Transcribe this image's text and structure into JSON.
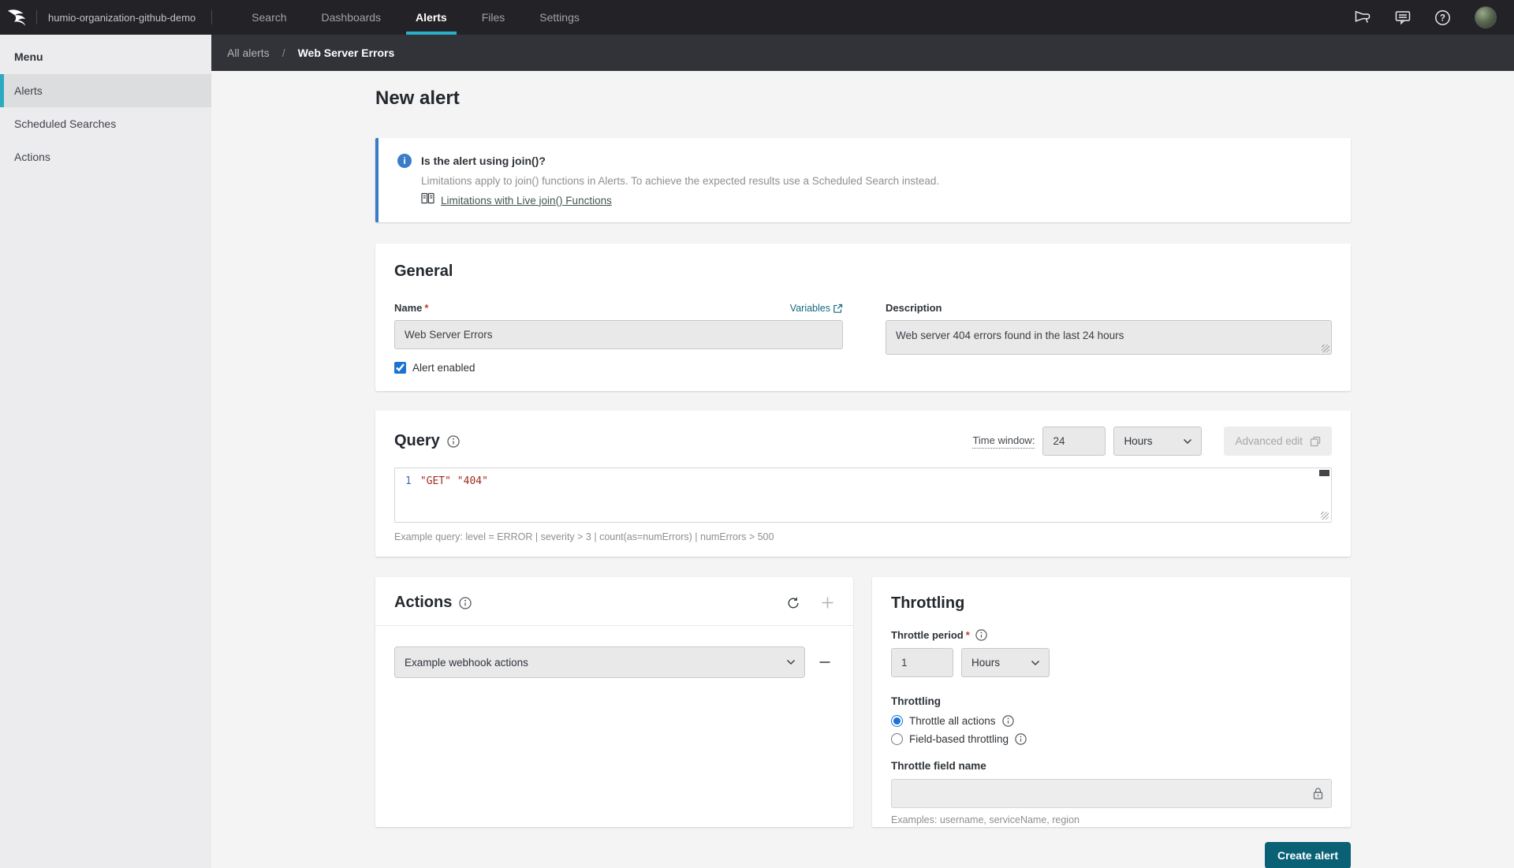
{
  "nav": {
    "org": "humio-organization-github-demo",
    "items": [
      "Search",
      "Dashboards",
      "Alerts",
      "Files",
      "Settings"
    ],
    "active_item": "Alerts"
  },
  "breadcrumb": {
    "parent": "All alerts",
    "separator": "/",
    "current": "Web Server Errors"
  },
  "sidebar": {
    "title": "Menu",
    "items": [
      "Alerts",
      "Scheduled Searches",
      "Actions"
    ],
    "active_item": "Alerts"
  },
  "page": {
    "title": "New alert"
  },
  "info_banner": {
    "title": "Is the alert using join()?",
    "body": "Limitations apply to join() functions in Alerts. To achieve the expected results use a Scheduled Search instead.",
    "link": "Limitations with Live join() Functions"
  },
  "general": {
    "heading": "General",
    "name_label": "Name",
    "required_mark": "*",
    "variables_link": "Variables",
    "name_value": "Web Server Errors",
    "description_label": "Description",
    "description_value": "Web server 404 errors found in the last 24 hours",
    "alert_enabled_label": "Alert enabled",
    "alert_enabled": true
  },
  "query": {
    "heading": "Query",
    "time_window_label": "Time window:",
    "time_window_value": "24",
    "time_window_unit": "Hours",
    "advanced_edit_label": "Advanced edit",
    "line_number": "1",
    "code": "\"GET\" \"404\"",
    "example": "Example query: level = ERROR | severity > 3 | count(as=numErrors) | numErrors > 500"
  },
  "actions": {
    "heading": "Actions",
    "selected_action": "Example webhook actions"
  },
  "throttling": {
    "heading": "Throttling",
    "period_label": "Throttle period",
    "required_mark": "*",
    "period_value": "1",
    "period_unit": "Hours",
    "subheading": "Throttling",
    "radio_all_label": "Throttle all actions",
    "radio_field_label": "Field-based throttling",
    "selected_radio": "Throttle all actions",
    "field_name_label": "Throttle field name",
    "field_name_value": "",
    "examples": "Examples: username, serviceName, region"
  },
  "footer": {
    "create_label": "Create alert"
  },
  "colors": {
    "navbar_bg": "#232327",
    "breadcrumb_bg": "#313338",
    "sidebar_bg": "#ececee",
    "page_bg": "#f4f4f5",
    "card_bg": "#ffffff",
    "accent_teal": "#29b0c7",
    "sidebar_active_teal": "#2aabc0",
    "button_teal": "#0a6175",
    "link_teal": "#156a7d",
    "info_blue": "#3a7cc9",
    "checkbox_blue": "#1b74d3",
    "query_code_red": "#9e2b20",
    "line_number_blue": "#4a66c0",
    "required_red": "#c0392b"
  }
}
